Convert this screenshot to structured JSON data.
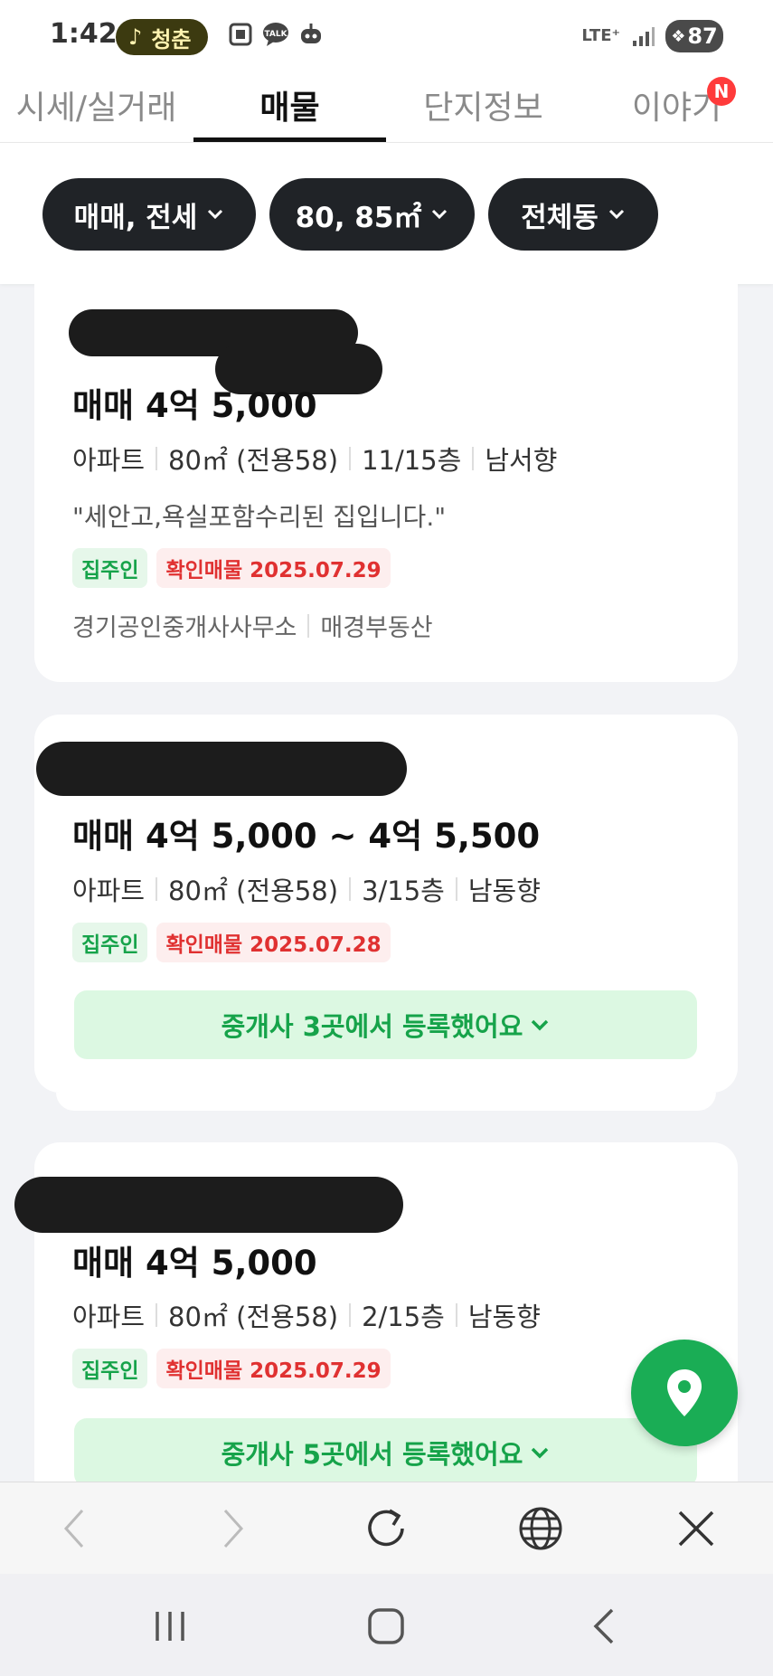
{
  "status_bar": {
    "time": "1:42",
    "music_label": "청춘",
    "network": "LTE⁺",
    "battery": "87"
  },
  "tabs": [
    {
      "label": "시세/실거래",
      "active": false
    },
    {
      "label": "매물",
      "active": true
    },
    {
      "label": "단지정보",
      "active": false
    },
    {
      "label": "이야기",
      "active": false
    }
  ],
  "tab_badge": "N",
  "filters": [
    {
      "label": "매매, 전세"
    },
    {
      "label": "80, 85㎡"
    },
    {
      "label": "전체동"
    }
  ],
  "listings": [
    {
      "price": "매매 4억 5,000",
      "info": [
        "아파트",
        "80㎡ (전용58)",
        "11/15층",
        "남서향"
      ],
      "description": "\"세안고,욕실포함수리된 집입니다.\"",
      "tag_owner": "집주인",
      "tag_confirm": "확인매물 2025.07.29",
      "agency": [
        "경기공인중개사사무소",
        "매경부동산"
      ]
    },
    {
      "price": "매매 4억 5,000 ~ 4억 5,500",
      "info": [
        "아파트",
        "80㎡ (전용58)",
        "3/15층",
        "남동향"
      ],
      "tag_owner": "집주인",
      "tag_confirm": "확인매물 2025.07.28",
      "brokers_button": "중개사 3곳에서 등록했어요"
    },
    {
      "price": "매매 4억 5,000",
      "info": [
        "아파트",
        "80㎡ (전용58)",
        "2/15층",
        "남동향"
      ],
      "tag_owner": "집주인",
      "tag_confirm": "확인매물 2025.07.29",
      "brokers_button": "중개사 5곳에서 등록했어요"
    }
  ],
  "colors": {
    "accent_green": "#16a34a",
    "confirm_red": "#e03131",
    "chip_dark": "#202327",
    "fab_green": "#1aad55"
  },
  "icons": {
    "fab": "map-pin-icon",
    "toolbar": [
      "back-arrow-icon",
      "forward-arrow-icon",
      "refresh-icon",
      "globe-icon",
      "close-icon"
    ],
    "system_nav": [
      "recent-apps-icon",
      "home-icon",
      "system-back-icon"
    ]
  }
}
